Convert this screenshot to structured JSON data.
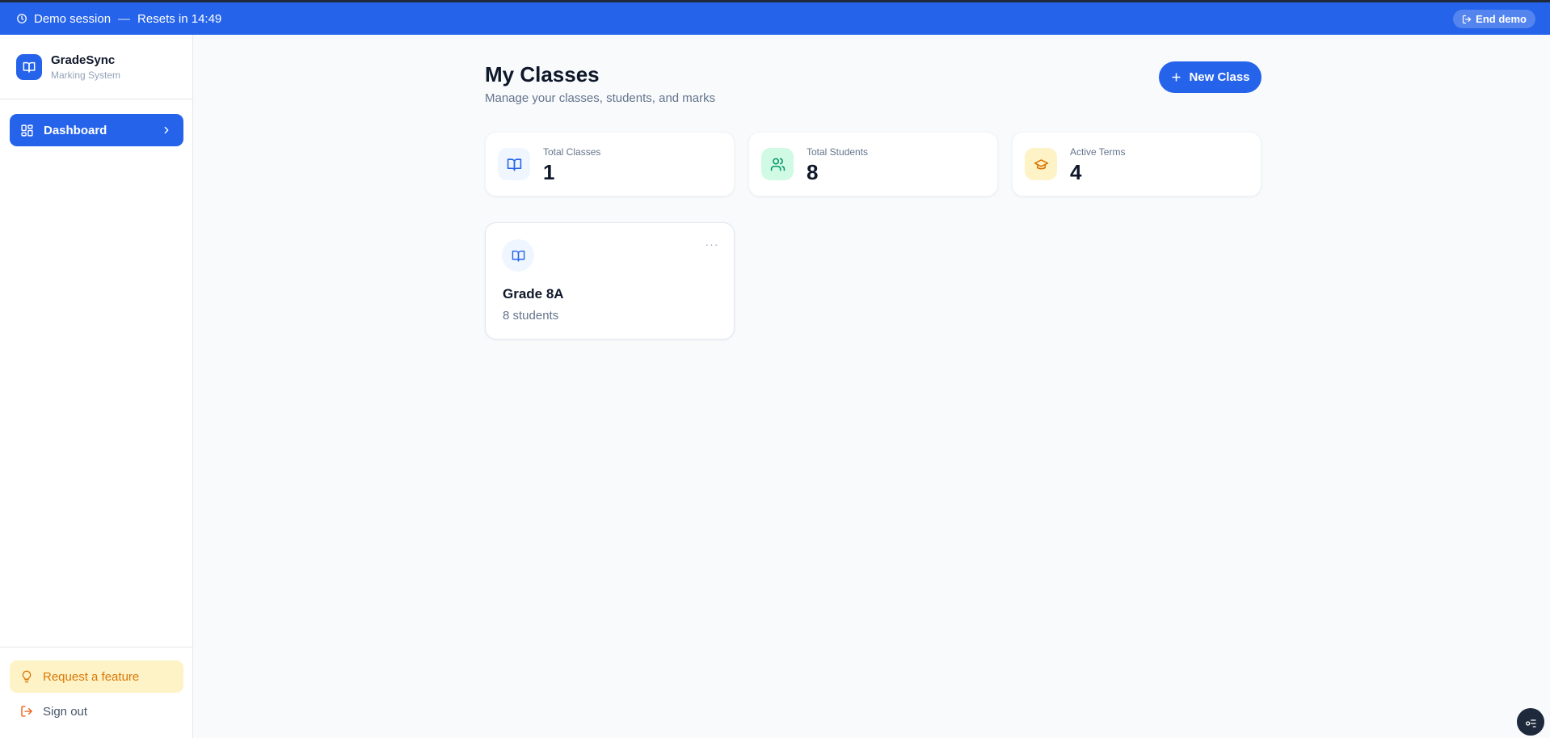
{
  "banner": {
    "session_label": "Demo session",
    "separator": "—",
    "reset_label": "Resets in 14:49",
    "end_button": "End demo",
    "color": "#2563eb"
  },
  "sidebar": {
    "brand_name": "GradeSync",
    "brand_subtitle": "Marking System",
    "nav_items": [
      {
        "label": "Dashboard",
        "icon": "layout-grid-icon",
        "active": true
      }
    ],
    "request_feature": "Request a feature",
    "sign_out": "Sign out"
  },
  "main": {
    "title": "My Classes",
    "subtitle": "Manage your classes, students, and marks",
    "new_class_button": "New Class",
    "stats": [
      {
        "label": "Total Classes",
        "value": "1",
        "icon": "book-open-icon",
        "color": "#2563eb"
      },
      {
        "label": "Total Students",
        "value": "8",
        "icon": "users-icon",
        "color": "#059669"
      },
      {
        "label": "Active Terms",
        "value": "4",
        "icon": "graduation-cap-icon",
        "color": "#d97706"
      }
    ],
    "classes": [
      {
        "name": "Grade 8A",
        "student_count": "8 students",
        "menu_label": "···"
      }
    ]
  },
  "accent_colors": {
    "primary": "#2563eb",
    "feature_bg": "#fef3c7",
    "feature_text": "#d97706"
  }
}
